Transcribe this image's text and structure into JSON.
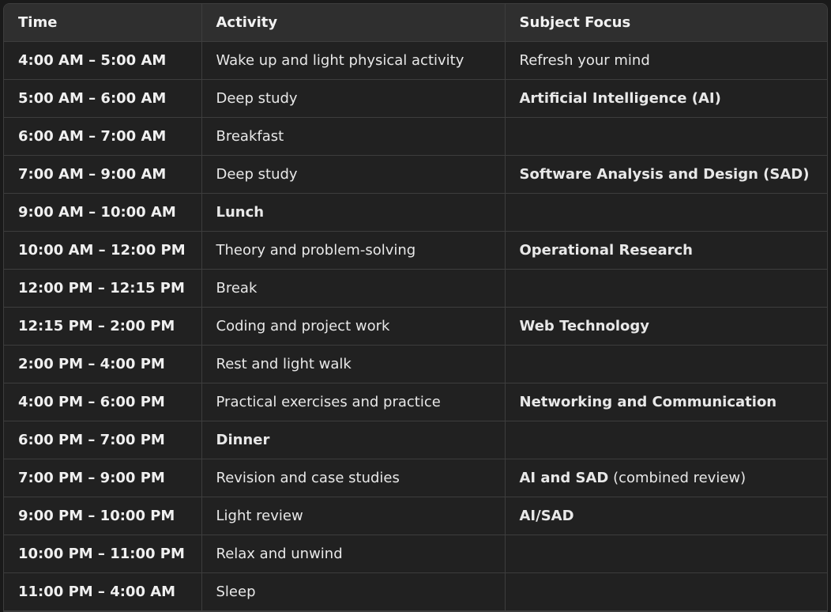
{
  "table": {
    "headers": [
      "Time",
      "Activity",
      "Subject Focus"
    ],
    "rows": [
      {
        "time": "4:00 AM – 5:00 AM",
        "activity": "Wake up and light physical activity",
        "activity_bold": false,
        "subject_bold": "",
        "subject_rest": "Refresh your mind"
      },
      {
        "time": "5:00 AM – 6:00 AM",
        "activity": "Deep study",
        "activity_bold": false,
        "subject_bold": "Artificial Intelligence (AI)",
        "subject_rest": ""
      },
      {
        "time": "6:00 AM – 7:00 AM",
        "activity": "Breakfast",
        "activity_bold": false,
        "subject_bold": "",
        "subject_rest": ""
      },
      {
        "time": "7:00 AM – 9:00 AM",
        "activity": "Deep study",
        "activity_bold": false,
        "subject_bold": "Software Analysis and Design (SAD)",
        "subject_rest": ""
      },
      {
        "time": "9:00 AM – 10:00 AM",
        "activity": "Lunch",
        "activity_bold": true,
        "subject_bold": "",
        "subject_rest": ""
      },
      {
        "time": "10:00 AM – 12:00 PM",
        "activity": "Theory and problem-solving",
        "activity_bold": false,
        "subject_bold": "Operational Research",
        "subject_rest": ""
      },
      {
        "time": "12:00 PM – 12:15 PM",
        "activity": "Break",
        "activity_bold": false,
        "subject_bold": "",
        "subject_rest": ""
      },
      {
        "time": "12:15 PM – 2:00 PM",
        "activity": "Coding and project work",
        "activity_bold": false,
        "subject_bold": "Web Technology",
        "subject_rest": ""
      },
      {
        "time": "2:00 PM – 4:00 PM",
        "activity": "Rest and light walk",
        "activity_bold": false,
        "subject_bold": "",
        "subject_rest": ""
      },
      {
        "time": "4:00 PM – 6:00 PM",
        "activity": "Practical exercises and practice",
        "activity_bold": false,
        "subject_bold": "Networking and Communication",
        "subject_rest": ""
      },
      {
        "time": "6:00 PM – 7:00 PM",
        "activity": "Dinner",
        "activity_bold": true,
        "subject_bold": "",
        "subject_rest": ""
      },
      {
        "time": "7:00 PM – 9:00 PM",
        "activity": "Revision and case studies",
        "activity_bold": false,
        "subject_bold": "AI and SAD",
        "subject_rest": " (combined review)"
      },
      {
        "time": "9:00 PM – 10:00 PM",
        "activity": "Light review",
        "activity_bold": false,
        "subject_bold": "AI/SAD",
        "subject_rest": ""
      },
      {
        "time": "10:00 PM – 11:00 PM",
        "activity": "Relax and unwind",
        "activity_bold": false,
        "subject_bold": "",
        "subject_rest": ""
      },
      {
        "time": "11:00 PM – 4:00 AM",
        "activity": "Sleep",
        "activity_bold": false,
        "subject_bold": "",
        "subject_rest": ""
      }
    ]
  }
}
